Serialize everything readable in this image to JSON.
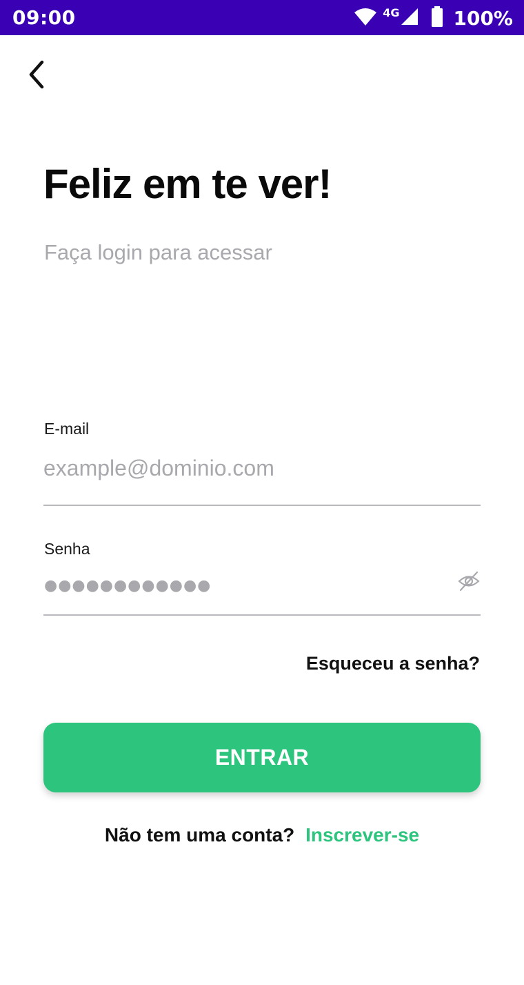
{
  "status_bar": {
    "time": "09:00",
    "network_label": "4G",
    "battery_percent": "100%",
    "background_color": "#3a00b3",
    "icons": [
      "wifi-icon",
      "cell-signal-icon",
      "battery-icon"
    ]
  },
  "navigation": {
    "back_icon": "chevron-left-icon"
  },
  "header": {
    "title": "Feliz em te ver!",
    "subtitle": "Faça login para acessar"
  },
  "form": {
    "email": {
      "label": "E-mail",
      "value": "",
      "placeholder": "example@dominio.com"
    },
    "password": {
      "label": "Senha",
      "masked_value": "●●●●●●●●●●●●",
      "toggle_icon": "eye-off-icon"
    },
    "forgot_password": "Esqueceu a senha?",
    "submit_label": "ENTRAR"
  },
  "signup": {
    "prompt": "Não tem uma conta?",
    "link": "Inscrever-se"
  },
  "colors": {
    "accent": "#2dc47e",
    "status_bar": "#3a00b3",
    "placeholder": "#a9a9ad"
  }
}
